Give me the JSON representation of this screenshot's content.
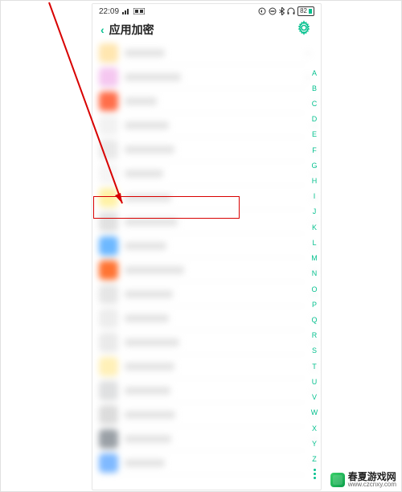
{
  "status": {
    "time": "22:09",
    "battery": "82"
  },
  "header": {
    "back_glyph": "‹",
    "title": "应用加密"
  },
  "accent_color": "#06c18f",
  "highlight_color": "#d80000",
  "apps": [
    {
      "color": "#ffe6b0",
      "label_w": 50
    },
    {
      "color": "#f5c7f0",
      "label_w": 70
    },
    {
      "color": "#ff6e4a",
      "label_w": 40
    },
    {
      "color": "#f2f2f2",
      "label_w": 55
    },
    {
      "color": "#e9e9e9",
      "label_w": 62
    },
    {
      "color": "#f5f5f5",
      "label_w": 48
    },
    {
      "color": "#fff2a6",
      "label_w": 58
    },
    {
      "color": "#e1e1e1",
      "label_w": 66
    },
    {
      "color": "#6db8ff",
      "label_w": 52
    },
    {
      "color": "#ff7433",
      "label_w": 74
    },
    {
      "color": "#e6e6e6",
      "label_w": 60
    },
    {
      "color": "#ededed",
      "label_w": 55
    },
    {
      "color": "#eaeaea",
      "label_w": 68
    },
    {
      "color": "#fff0b8",
      "label_w": 62
    },
    {
      "color": "#dfe0e1",
      "label_w": 57
    },
    {
      "color": "#dcdcdc",
      "label_w": 63
    },
    {
      "color": "#9aa0a6",
      "label_w": 58
    },
    {
      "color": "#7fb9ff",
      "label_w": 50
    }
  ],
  "index_letters": [
    "A",
    "B",
    "C",
    "D",
    "E",
    "F",
    "G",
    "H",
    "I",
    "J",
    "K",
    "L",
    "M",
    "N",
    "O",
    "P",
    "Q",
    "R",
    "S",
    "T",
    "U",
    "V",
    "W",
    "X",
    "Y",
    "Z"
  ],
  "watermark": {
    "title": "春夏游戏网",
    "url": "www.czcnxy.com"
  }
}
